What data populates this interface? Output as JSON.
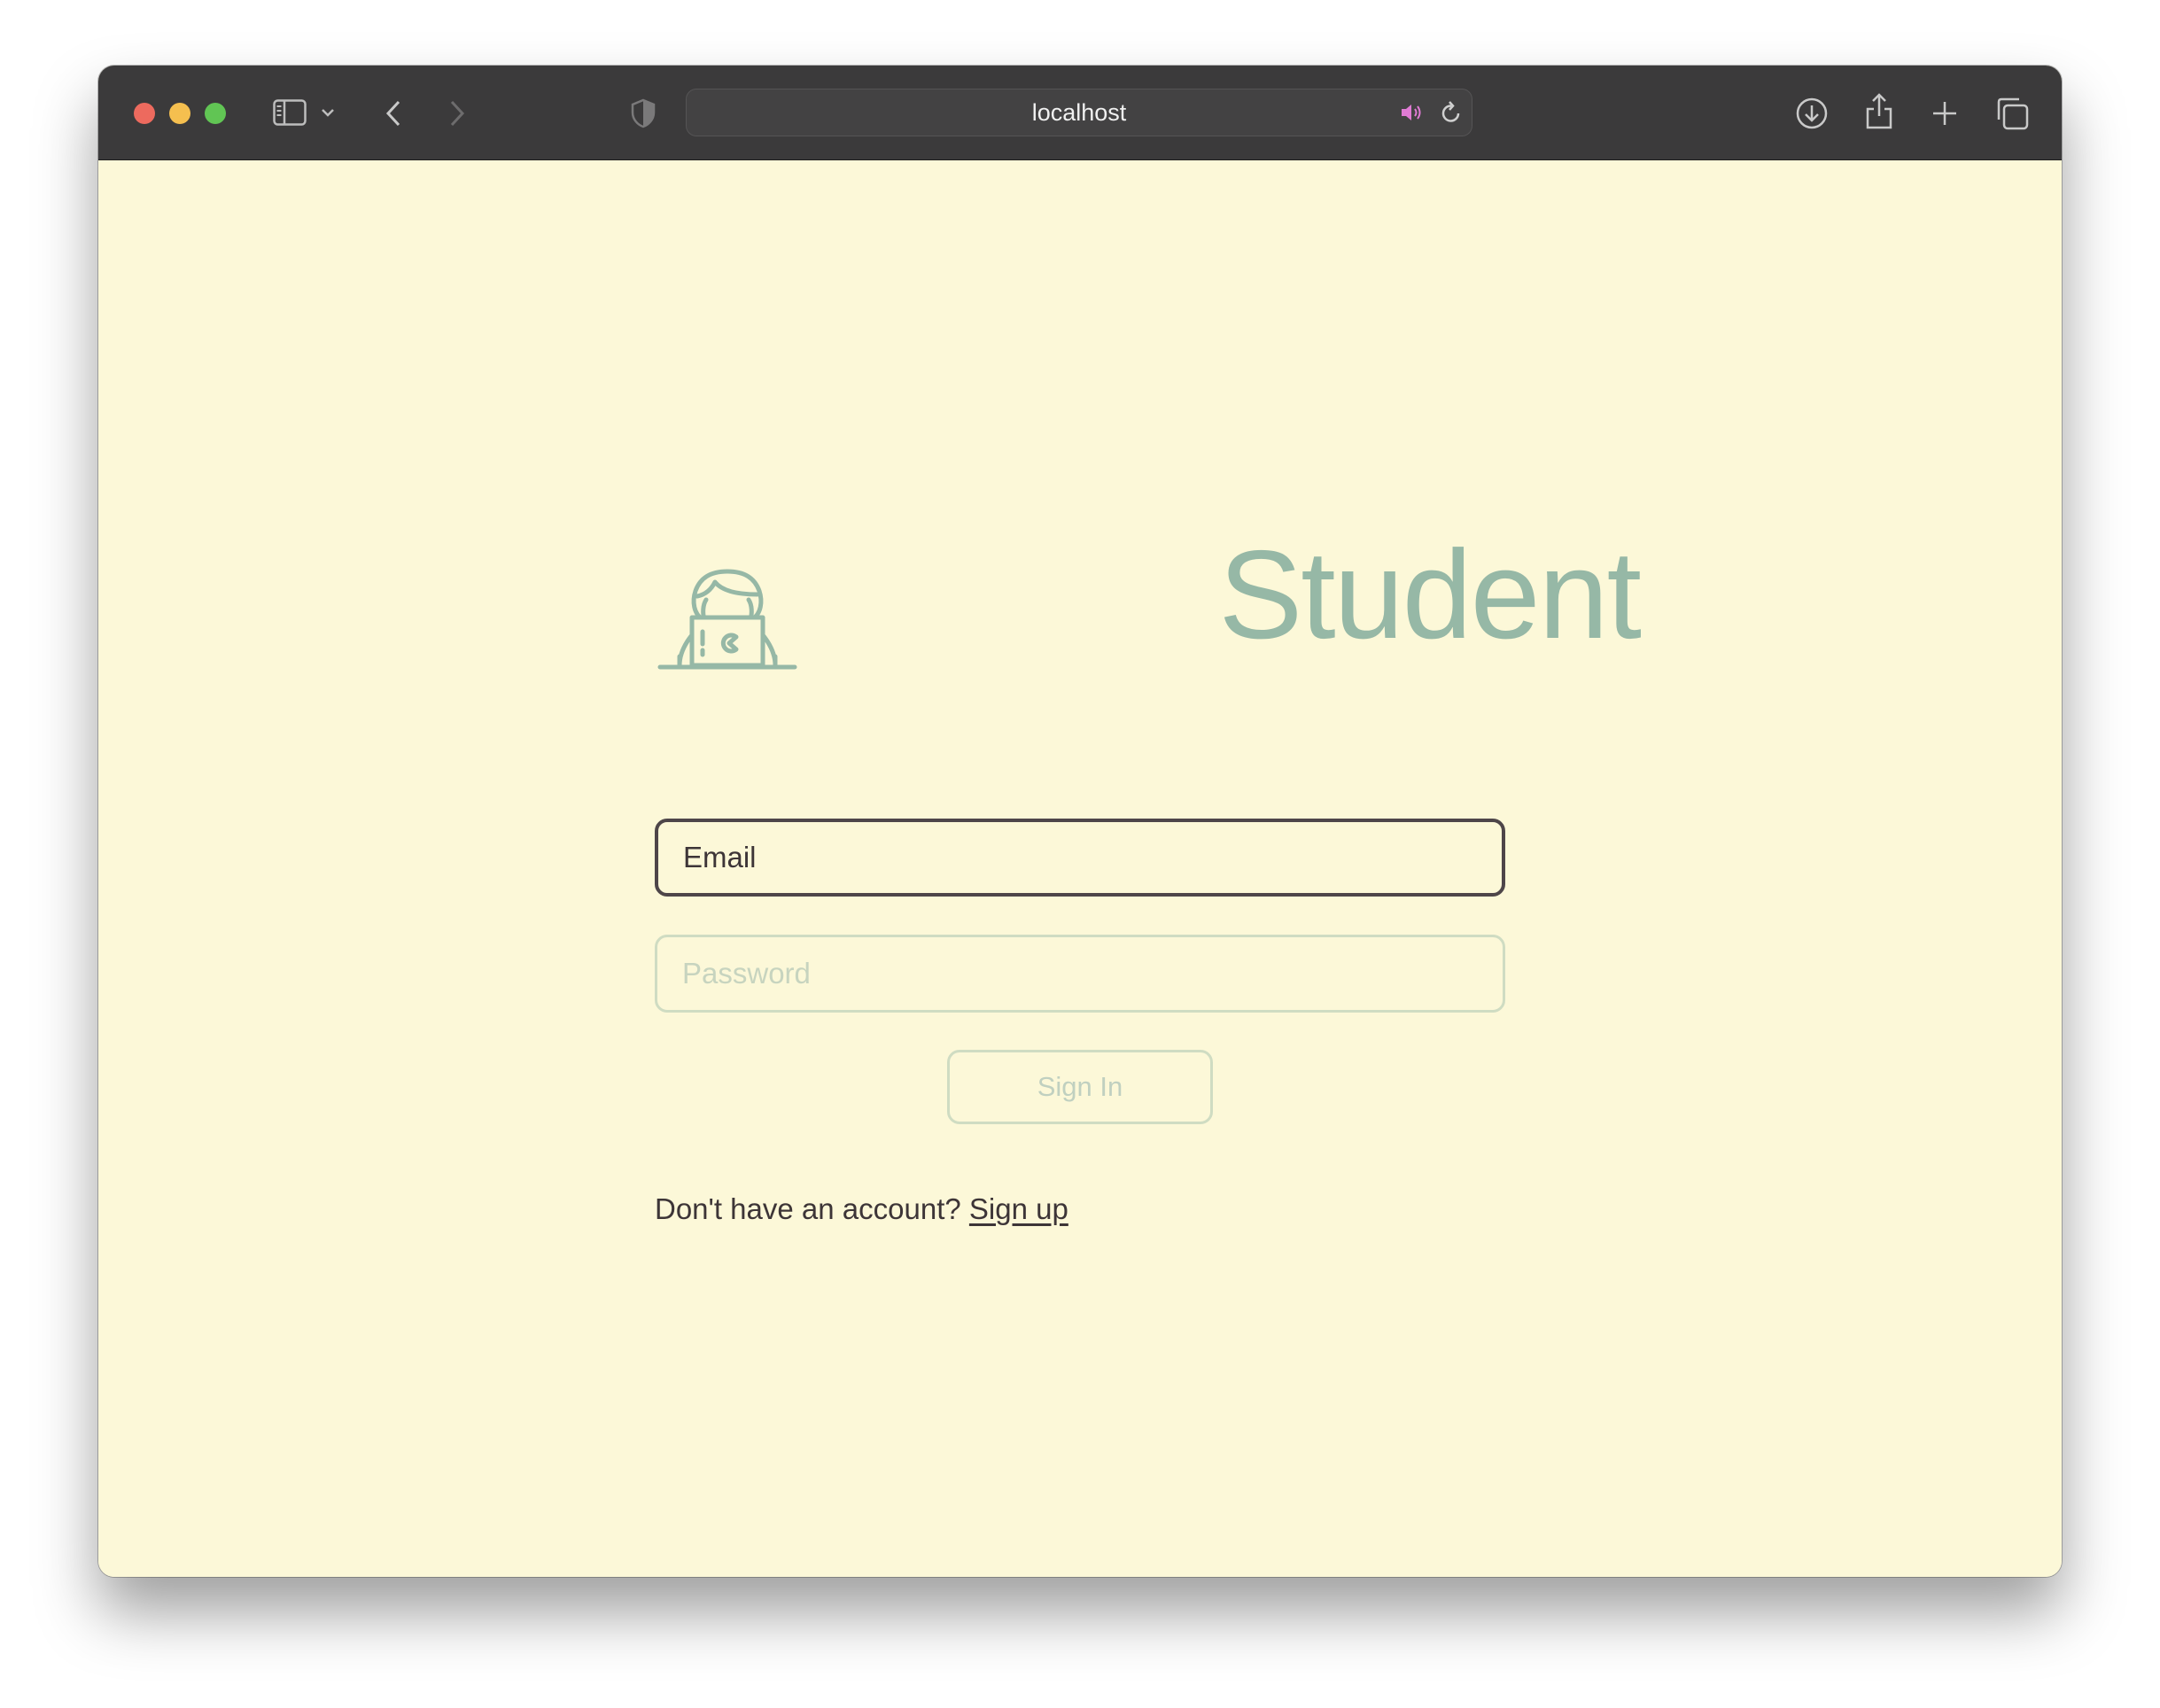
{
  "browser": {
    "url": "localhost",
    "icons": {
      "sidebar": "sidebar-icon",
      "chevron": "chevron-down-icon",
      "back": "back-arrow-icon",
      "forward": "forward-arrow-icon",
      "shield": "shield-icon",
      "audio": "speaker-icon",
      "reload": "reload-icon",
      "download": "download-icon",
      "share": "share-icon",
      "new_tab": "plus-icon",
      "tabs": "tabs-overview-icon"
    },
    "colors": {
      "titlebar": "#3b3a3b",
      "audio_icon": "#e07bd4"
    }
  },
  "page": {
    "brand": {
      "title": "Student",
      "icon": "student-laptop-icon",
      "color": "#96b8a6"
    },
    "form": {
      "email_placeholder": "Email",
      "password_placeholder": "Password",
      "signin_label": "Sign In"
    },
    "signup": {
      "prompt": "Don't have an account?",
      "link_label": "Sign up"
    },
    "colors": {
      "background": "#fcf8d8",
      "text": "#3d3537",
      "muted_border": "#cfdcc2"
    }
  }
}
